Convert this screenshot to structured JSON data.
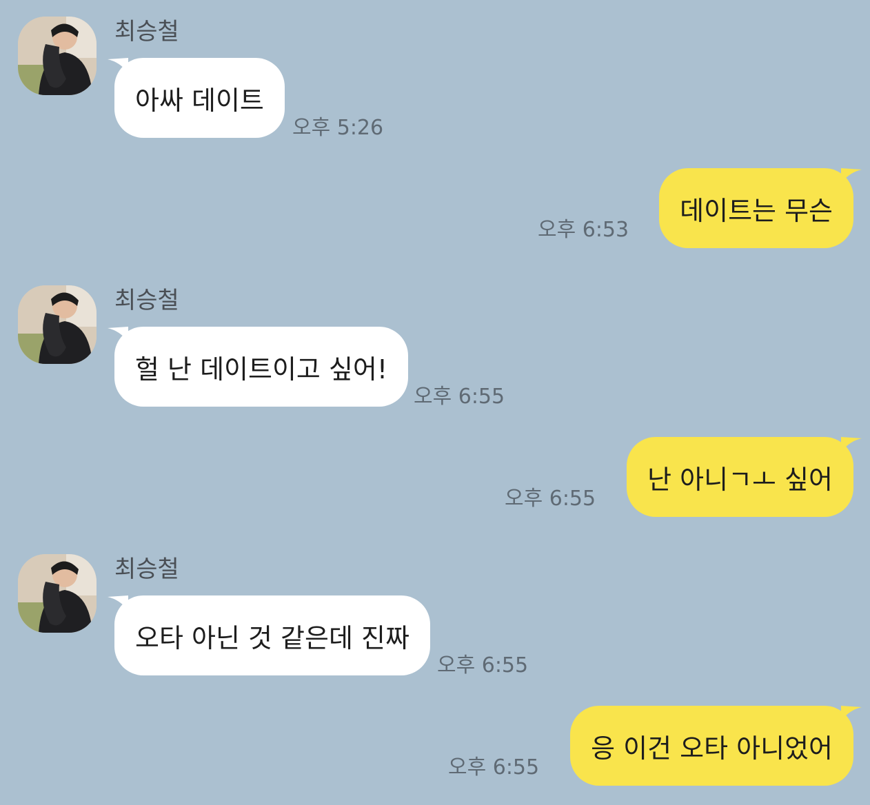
{
  "chat": {
    "messages": [
      {
        "direction": "in",
        "sender": "최승철",
        "text": "아싸 데이트",
        "time": "오후 5:26"
      },
      {
        "direction": "out",
        "text": "데이트는 무슨",
        "time": "오후 6:53"
      },
      {
        "direction": "in",
        "sender": "최승철",
        "text": "헐 난 데이트이고 싶어!",
        "time": "오후 6:55"
      },
      {
        "direction": "out",
        "text": "난 아니ㄱㅗ 싶어",
        "time": "오후 6:55"
      },
      {
        "direction": "in",
        "sender": "최승철",
        "text": "오타 아닌 것 같은데 진짜",
        "time": "오후 6:55"
      },
      {
        "direction": "out",
        "text": "응 이건 오타 아니었어",
        "time": "오후 6:55"
      }
    ]
  },
  "colors": {
    "background": "#abc0d0",
    "incoming_bubble": "#ffffff",
    "outgoing_bubble": "#f9e44c"
  },
  "icons": {
    "avatar": "profile-photo-icon"
  }
}
